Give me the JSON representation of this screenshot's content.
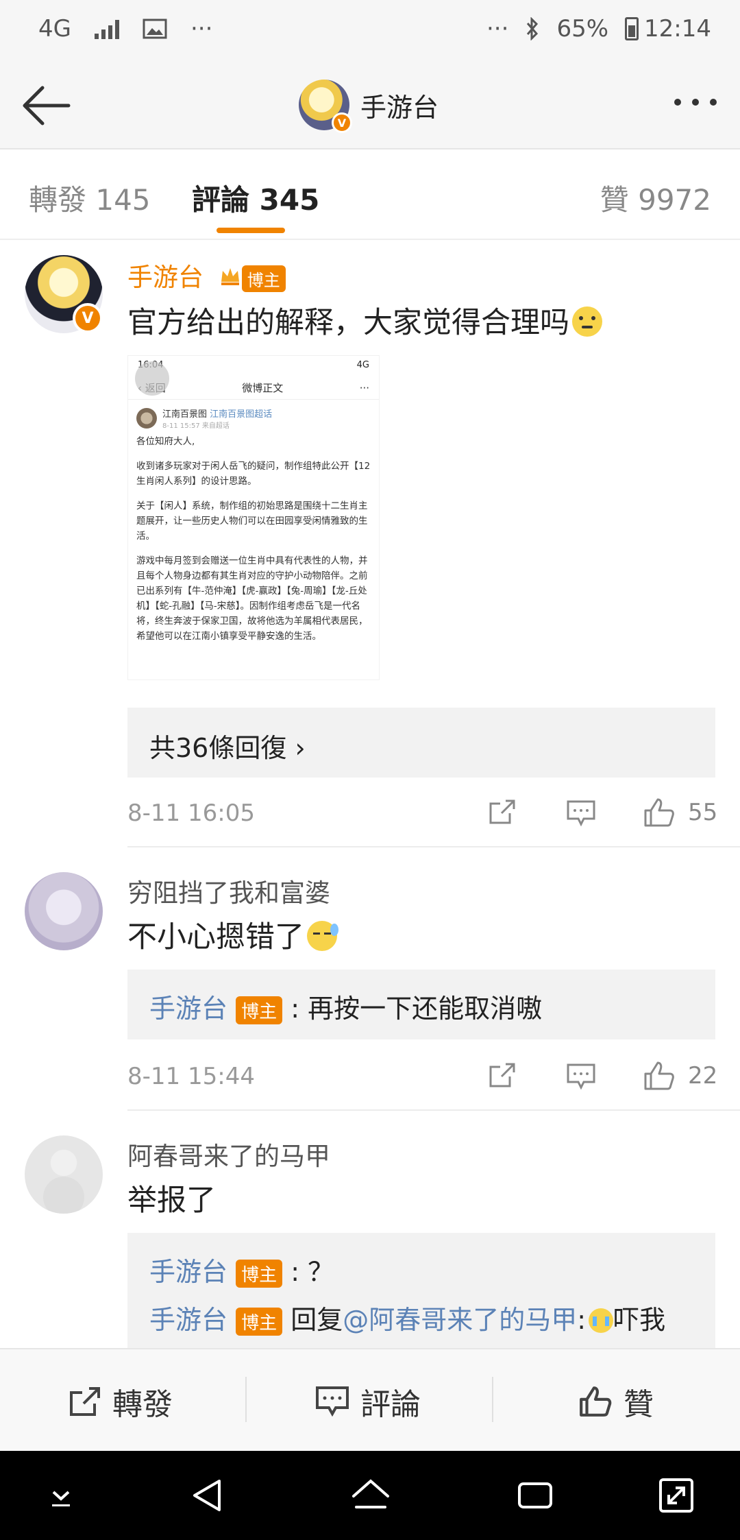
{
  "status_bar": {
    "network": "4G",
    "ellipsis_left": "···",
    "ellipsis_right": "···",
    "battery": "65%",
    "time": "12:14"
  },
  "header": {
    "title": "手游台"
  },
  "tabs": [
    {
      "label": "轉發 145"
    },
    {
      "label": "評論 345"
    },
    {
      "label": "贊 9972"
    }
  ],
  "main_comment": {
    "author": "手游台",
    "author_tag": "博主",
    "text": "官方给出的解释，大家觉得合理吗",
    "embedded_screenshot": {
      "status_time": "16:04",
      "status_right": "4G",
      "back_label": "返回",
      "title": "微博正文",
      "more": "···",
      "user": "江南百景图",
      "user_link": "江南百景图超话",
      "timestamp": "8-11 15:57 来自超话",
      "paragraphs": [
        "各位知府大人,",
        "收到诸多玩家对于闲人岳飞的疑问，制作组特此公开【12生肖闲人系列】的设计思路。",
        "关于【闲人】系统，制作组的初始思路是围绕十二生肖主题展开，让一些历史人物们可以在田园享受闲情雅致的生活。",
        "游戏中每月签到会赠送一位生肖中具有代表性的人物，并且每个人物身边都有其生肖对应的守护小动物陪伴。之前已出系列有【牛-范仲淹】【虎-赢政】【兔-周瑜】【龙-丘处机】【蛇-孔融】【马-宋慈】。因制作组考虑岳飞是一代名将，终生奔波于保家卫国，故将他选为羊属相代表居民，希望他可以在江南小镇享受平静安逸的生活。"
      ]
    },
    "replies_link": "共36條回復",
    "date": "8-11 16:05",
    "likes": "55"
  },
  "comments": [
    {
      "author": "穷阻挡了我和富婆",
      "text": "不小心摁错了",
      "reply": {
        "author": "手游台",
        "tag": "博主",
        "text": ": 再按一下还能取消嗷"
      },
      "date": "8-11 15:44",
      "likes": "22"
    },
    {
      "author": "阿春哥来了的马甲",
      "text": "举报了",
      "replies": [
        {
          "author": "手游台",
          "tag": "博主",
          "text": ": ？"
        },
        {
          "author": "手游台",
          "tag": "博主",
          "prefix": "回复",
          "mention": "@阿春哥来了的马甲",
          "suffix_colon": ":",
          "text": "吓我"
        }
      ]
    }
  ],
  "bottom_bar": {
    "forward": "轉發",
    "comment": "評論",
    "like": "贊"
  },
  "colors": {
    "accent": "#f08300",
    "link": "#5b82b6",
    "reply_bg": "#f2f2f2"
  }
}
